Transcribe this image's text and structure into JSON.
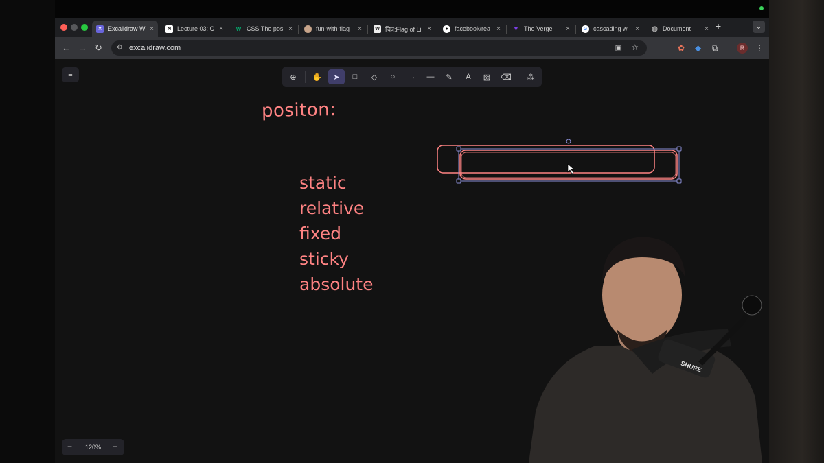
{
  "browser": {
    "tabs": [
      {
        "title": "Excalidraw W",
        "favicon": "excalidraw-icon",
        "active": true
      },
      {
        "title": "Lecture 03: C",
        "favicon": "notion-icon",
        "active": false
      },
      {
        "title": "CSS The pos",
        "favicon": "w3-icon",
        "active": false
      },
      {
        "title": "fun-with-flag",
        "favicon": "avatar-icon",
        "active": false
      },
      {
        "title": "चित्र:Flag of Li",
        "favicon": "wikipedia-icon",
        "active": false
      },
      {
        "title": "facebook/rea",
        "favicon": "github-icon",
        "active": false
      },
      {
        "title": "The Verge",
        "favicon": "verge-icon",
        "active": false
      },
      {
        "title": "cascading w",
        "favicon": "google-icon",
        "active": false
      },
      {
        "title": "Document",
        "favicon": "globe-icon",
        "active": false
      }
    ],
    "close_glyph": "×",
    "new_tab_glyph": "+",
    "url": "excalidraw.com",
    "profile_initial": "R"
  },
  "excalidraw": {
    "menu_glyph": "≡",
    "tools": [
      "lock-icon",
      "hand-icon",
      "selection-icon",
      "rectangle-icon",
      "diamond-icon",
      "ellipse-icon",
      "arrow-icon",
      "line-icon",
      "pencil-icon",
      "text-icon",
      "image-icon",
      "eraser-icon",
      "library-icon"
    ],
    "selected_tool": "selection-icon",
    "heading": "positon:",
    "list": [
      "static",
      "relative",
      "fixed",
      "sticky",
      "absolute"
    ],
    "zoom": {
      "out": "−",
      "level": "120%",
      "in": "+"
    },
    "stroke_color": "#ff8383",
    "selection_color": "#8b8fd6"
  },
  "colors": {
    "canvas": "#121212",
    "toolbar": "#232329",
    "tab_active": "#35363a"
  }
}
